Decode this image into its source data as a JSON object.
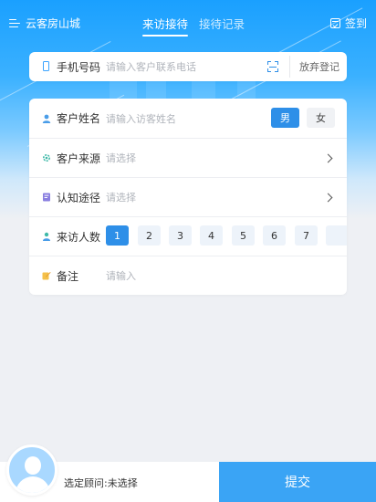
{
  "header": {
    "app_name": "云客房山城",
    "tabs": [
      {
        "label": "来访接待",
        "active": true
      },
      {
        "label": "接待记录",
        "active": false
      }
    ],
    "signin_label": "签到"
  },
  "phone": {
    "label": "手机号码",
    "placeholder": "请输入客户联系电话",
    "abandon_label": "放弃登记"
  },
  "form": {
    "customer_name": {
      "label": "客户姓名",
      "placeholder": "请输入访客姓名"
    },
    "gender": {
      "male": "男",
      "female": "女",
      "selected": "男"
    },
    "customer_source": {
      "label": "客户来源",
      "placeholder": "请选择"
    },
    "awareness_channel": {
      "label": "认知途径",
      "placeholder": "请选择"
    },
    "visitor_count": {
      "label": "来访人数",
      "options": [
        "1",
        "2",
        "3",
        "4",
        "5",
        "6",
        "7"
      ],
      "selected": "1"
    },
    "remarks": {
      "label": "备注",
      "placeholder": "请输入"
    }
  },
  "footer": {
    "adviser_label": "选定顾问:",
    "adviser_value": "未选择",
    "submit_label": "提交"
  },
  "colors": {
    "primary": "#2e8fe8",
    "submit": "#3aa4f5",
    "header_gradient_top": "#1aa0ff"
  }
}
